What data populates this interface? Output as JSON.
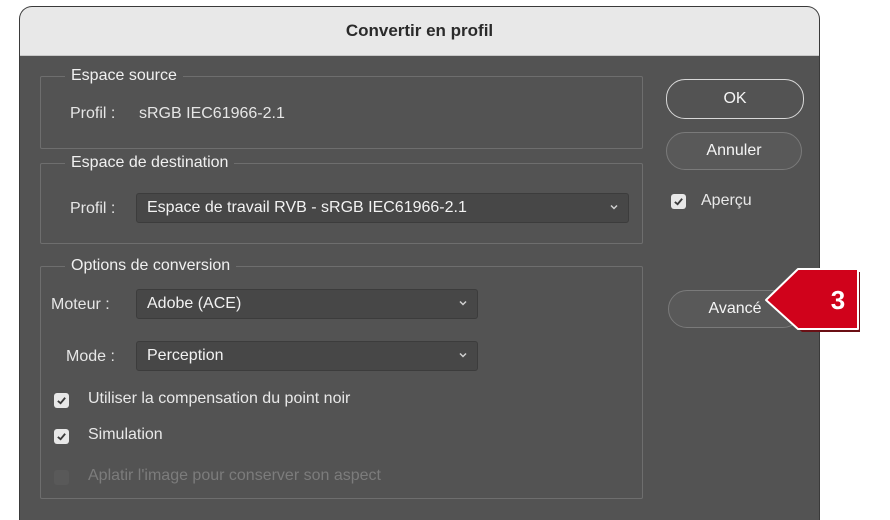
{
  "dialog": {
    "title": "Convertir en profil",
    "source": {
      "legend": "Espace source",
      "profile_label": "Profil :",
      "profile_value": "sRGB IEC61966-2.1"
    },
    "destination": {
      "legend": "Espace de destination",
      "profile_label": "Profil :",
      "profile_value": "Espace de travail RVB - sRGB IEC61966-2.1"
    },
    "options": {
      "legend": "Options de conversion",
      "engine_label": "Moteur :",
      "engine_value": "Adobe (ACE)",
      "mode_label": "Mode :",
      "mode_value": "Perception",
      "black_point_label": "Utiliser la compensation du point noir",
      "black_point_checked": true,
      "simulation_label": "Simulation",
      "simulation_checked": true,
      "flatten_label": "Aplatir l'image pour conserver son aspect",
      "flatten_checked": false,
      "flatten_enabled": false
    },
    "buttons": {
      "ok": "OK",
      "cancel": "Annuler",
      "advanced": "Avancé"
    },
    "preview": {
      "label": "Aperçu",
      "checked": true
    }
  },
  "callout": {
    "number": "3",
    "color": "#d0021b"
  },
  "colors": {
    "dialog_bg": "#535353",
    "titlebar_bg": "#e8e8e8",
    "group_border": "#6e6e6e"
  }
}
